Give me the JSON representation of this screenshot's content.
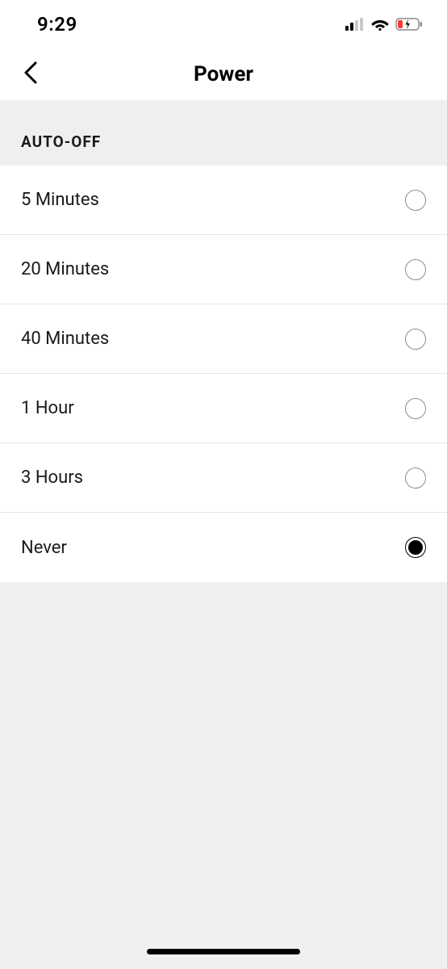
{
  "status_bar": {
    "time": "9:29"
  },
  "nav": {
    "title": "Power"
  },
  "section": {
    "title": "AUTO-OFF"
  },
  "options": [
    {
      "label": "5 Minutes",
      "selected": false
    },
    {
      "label": "20 Minutes",
      "selected": false
    },
    {
      "label": "40 Minutes",
      "selected": false
    },
    {
      "label": "1 Hour",
      "selected": false
    },
    {
      "label": "3 Hours",
      "selected": false
    },
    {
      "label": "Never",
      "selected": true
    }
  ]
}
